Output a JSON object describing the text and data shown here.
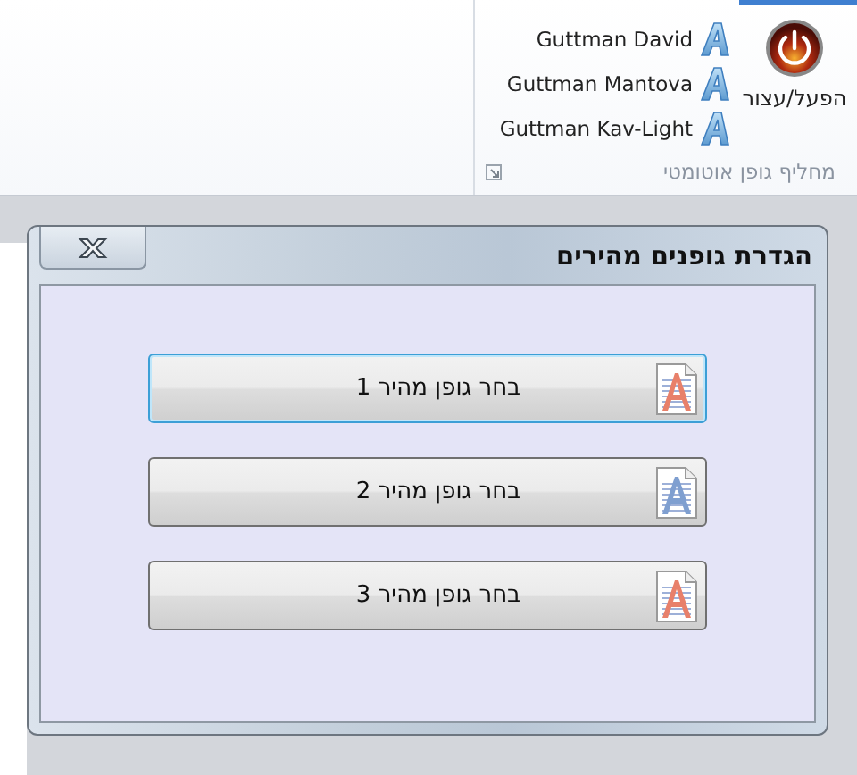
{
  "ribbon": {
    "fonts": [
      {
        "label": "Guttman David"
      },
      {
        "label": "Guttman Mantova"
      },
      {
        "label": "Guttman Kav-Light"
      }
    ],
    "toggle": {
      "label": "הפעל/עצור"
    },
    "group_label": "מחליף גופן אוטומטי"
  },
  "dialog": {
    "title": "הגדרת גופנים מהירים",
    "buttons": [
      {
        "label": "בחר גופן מהיר 1",
        "focused": true,
        "color": "#e8806a"
      },
      {
        "label": "בחר גופן מהיר 2",
        "focused": false,
        "color": "#7f9fd0"
      },
      {
        "label": "בחר גופן מהיר 3",
        "focused": false,
        "color": "#e8806a"
      }
    ]
  }
}
